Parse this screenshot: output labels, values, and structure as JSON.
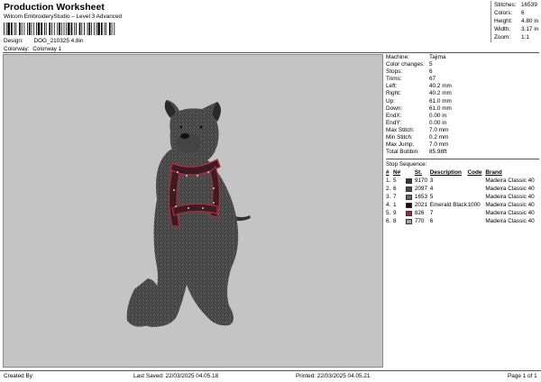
{
  "header": {
    "title": "Production Worksheet",
    "subtitle": "Wilcom EmbroideryStudio – Level 3 Advanced"
  },
  "design_info": {
    "design_label": "Design:",
    "design_value": "DOG_210325 4.8in",
    "colorway_label": "Colorway:",
    "colorway_value": "Colorway 1"
  },
  "summary": [
    {
      "label": "Stitches:",
      "value": "16539"
    },
    {
      "label": "Colors:",
      "value": "6"
    },
    {
      "label": "Height:",
      "value": "4.80 in"
    },
    {
      "label": "Width:",
      "value": "3.17 in"
    },
    {
      "label": "Zoom:",
      "value": "1:1"
    }
  ],
  "machine_info": [
    {
      "label": "Machine:",
      "value": "Tajima"
    },
    {
      "label": "Color changes:",
      "value": "5"
    },
    {
      "label": "Stops:",
      "value": "6"
    },
    {
      "label": "Trims:",
      "value": "67"
    },
    {
      "label": "Left:",
      "value": "40.2 mm"
    },
    {
      "label": "Right:",
      "value": "40.2 mm"
    },
    {
      "label": "Up:",
      "value": "61.0 mm"
    },
    {
      "label": "Down:",
      "value": "61.0 mm"
    },
    {
      "label": "EndX:",
      "value": "0.00 in"
    },
    {
      "label": "EndY:",
      "value": "0.00 in"
    },
    {
      "label": "Max Stitch:",
      "value": "7.0 mm"
    },
    {
      "label": "Min Stitch:",
      "value": "0.2 mm"
    },
    {
      "label": "Max Jump:",
      "value": "7.0 mm"
    },
    {
      "label": "Total Bobbin:",
      "value": "85.98ft"
    }
  ],
  "stop_sequence": {
    "title": "Stop Sequence:",
    "headers": [
      "#",
      "N#",
      "St.",
      "Description",
      "Code",
      "Brand"
    ],
    "rows": [
      {
        "num": "1.",
        "n": "5",
        "color": "#3a3a3a",
        "st": "9170",
        "desc": "3",
        "code": "",
        "brand": "Madeira Classic 40"
      },
      {
        "num": "2.",
        "n": "6",
        "color": "#4a4a4a",
        "st": "2097",
        "desc": "4",
        "code": "",
        "brand": "Madeira Classic 40"
      },
      {
        "num": "3.",
        "n": "7",
        "color": "#6a6a6a",
        "st": "1653",
        "desc": "5",
        "code": "",
        "brand": "Madeira Classic 40"
      },
      {
        "num": "4.",
        "n": "1",
        "color": "#111111",
        "st": "2021",
        "desc": "Emerald Black",
        "code": "1000",
        "brand": "Madeira Classic 40"
      },
      {
        "num": "5.",
        "n": "9",
        "color": "#a8283a",
        "st": "826",
        "desc": "7",
        "code": "",
        "brand": "Madeira Classic 40"
      },
      {
        "num": "6.",
        "n": "8",
        "color": "#9aa8b4",
        "st": "770",
        "desc": "6",
        "code": "",
        "brand": "Madeira Classic 40"
      }
    ]
  },
  "footer": {
    "created_by": "Created By:",
    "last_saved": "Last Saved: 22/03/2025 04.05.18",
    "printed": "Printed: 22/03/2025 04.05.21",
    "page": "Page 1 of 1"
  }
}
